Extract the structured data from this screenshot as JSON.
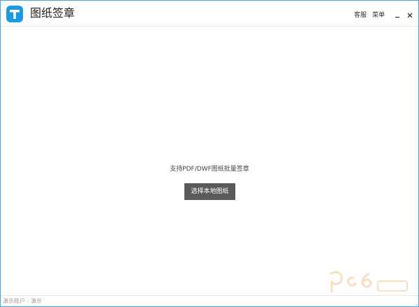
{
  "app": {
    "title": "图纸签章"
  },
  "titlebar": {
    "links": [
      {
        "label": "客服"
      },
      {
        "label": "菜单"
      }
    ],
    "minimize_label": "-",
    "close_icon": "close-icon"
  },
  "main": {
    "hint": "支持PDF/DWF图纸批量签章",
    "select_button": "选择本地图纸"
  },
  "status": {
    "text": "演示账户 - 演示"
  },
  "colors": {
    "accent": "#1e9be0",
    "button_bg": "#5a5a5a",
    "border": "#4aa3df"
  }
}
